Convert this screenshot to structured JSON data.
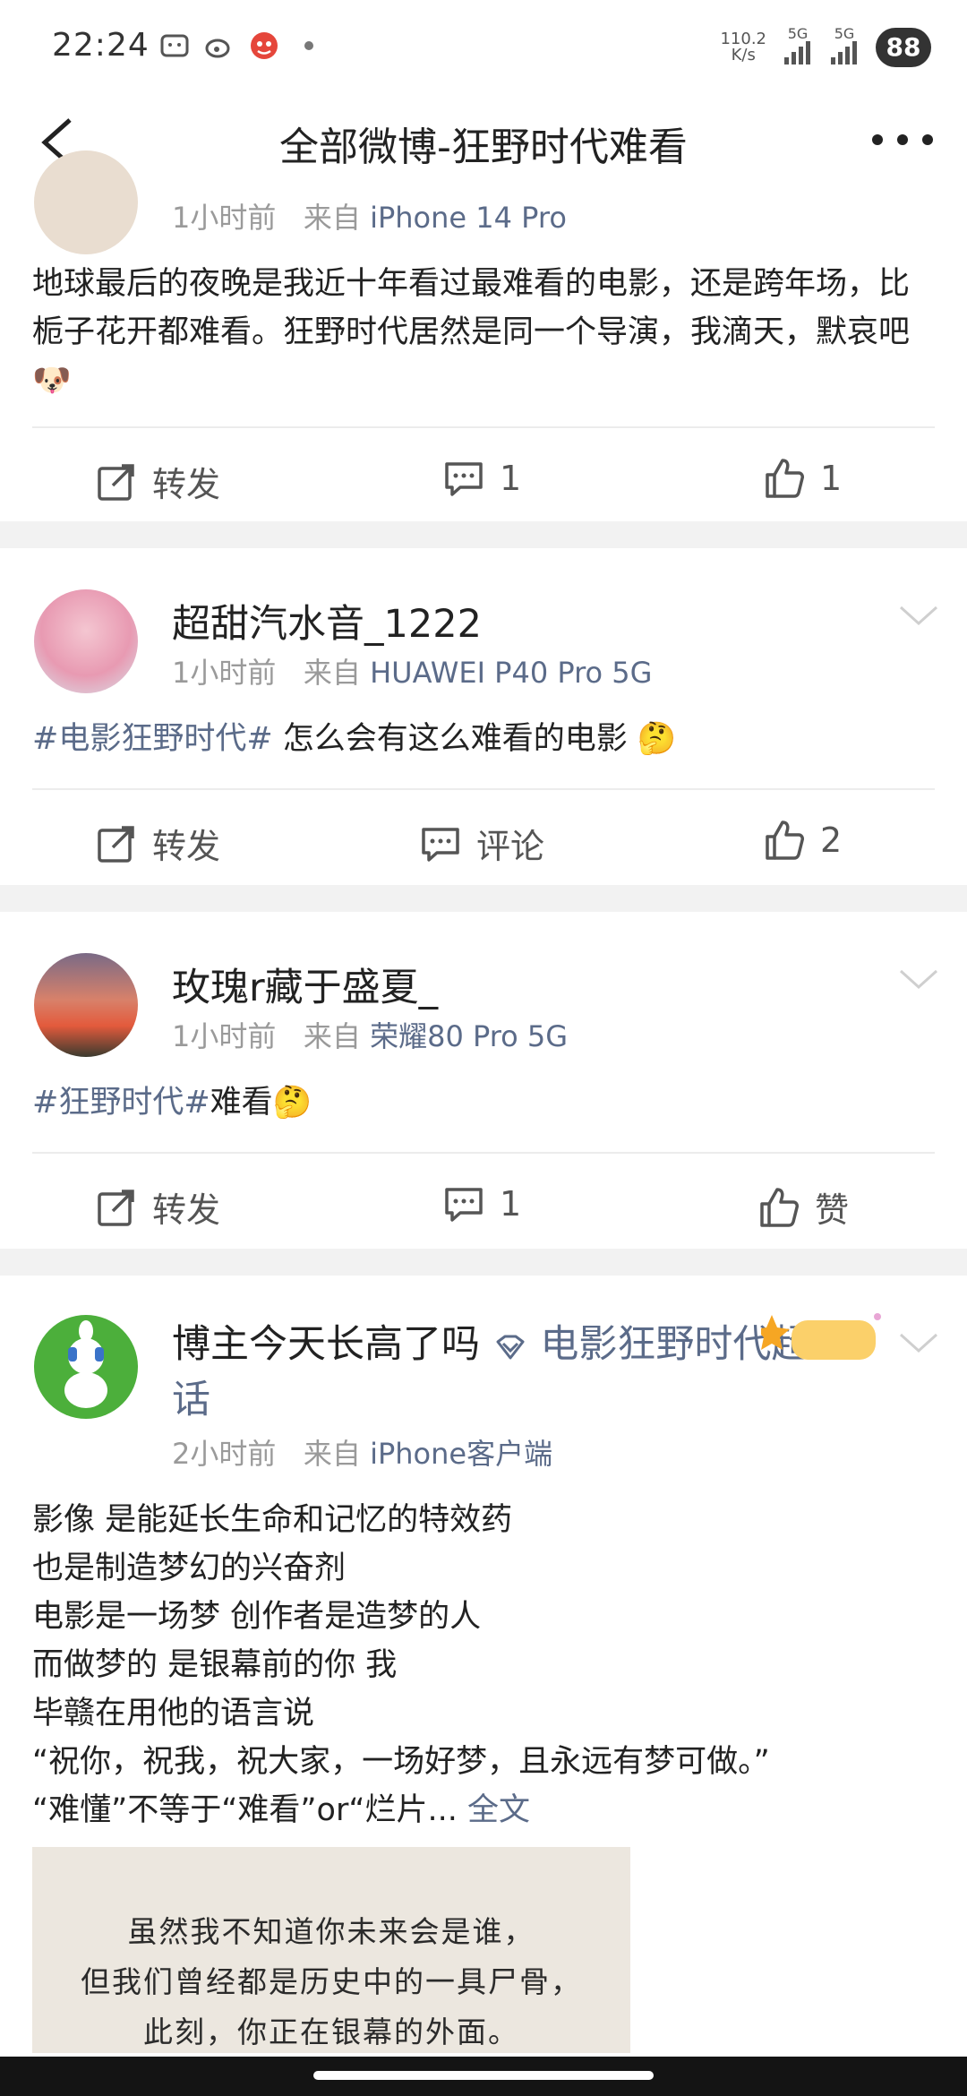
{
  "status_bar": {
    "time": "22:24",
    "net_speed_value": "110.2",
    "net_speed_unit": "K/s",
    "sig1": "5G",
    "sig2": "5G",
    "battery": "88"
  },
  "header": {
    "title": "全部微博-狂野时代难看"
  },
  "posts": [
    {
      "meta_time": "1小时前",
      "meta_from": "来自",
      "meta_source": "iPhone 14 Pro",
      "text": "地球最后的夜晚是我近十年看过最难看的电影，还是跨年场，比栀子花开都难看。狂野时代居然是同一个导演，我滴天，默哀吧",
      "actions": {
        "repost": "转发",
        "comment": "1",
        "like": "1"
      }
    },
    {
      "username": "超甜汽水音_1222",
      "meta_time": "1小时前",
      "meta_from": "来自",
      "meta_source": "HUAWEI P40 Pro 5G",
      "hashtag": "#电影狂野时代#",
      "text": " 怎么会有这么难看的电影 ",
      "actions": {
        "repost": "转发",
        "comment": "评论",
        "like": "2"
      }
    },
    {
      "username": "玫瑰r藏于盛夏_",
      "meta_time": "1小时前",
      "meta_from": "来自",
      "meta_source": "荣耀80 Pro 5G",
      "hashtag": "#狂野时代#",
      "text": "难看",
      "actions": {
        "repost": "转发",
        "comment": "1",
        "like": "赞"
      }
    },
    {
      "username": "博主今天长高了吗",
      "topic": "电影狂野时代超话",
      "meta_time": "2小时前",
      "meta_from": "来自",
      "meta_source": "iPhone客户端",
      "lines": [
        "影像 是能延长生命和记忆的特效药",
        "也是制造梦幻的兴奋剂",
        "电影是一场梦 创作者是造梦的人",
        "而做梦的 是银幕前的你 我",
        "毕赣在用他的语言说",
        "“祝你，祝我，祝大家，一场好梦，且永远有梦可做。”",
        "“难懂”不等于“难看”or“烂片..."
      ],
      "full_text_link": "全文",
      "image_lines": [
        "虽然我不知道你未来会是谁，",
        "但我们曾经都是历史中的一具尸骨，",
        "此刻，你正在银幕的外面。"
      ]
    }
  ],
  "colors": {
    "link": "#5b6b89",
    "background": "#f2f2f2",
    "card": "#ffffff"
  },
  "icons": [
    "back-arrow-icon",
    "more-dots-icon",
    "repost-icon",
    "comment-icon",
    "like-icon",
    "chevron-down-icon",
    "super-topic-icon"
  ]
}
